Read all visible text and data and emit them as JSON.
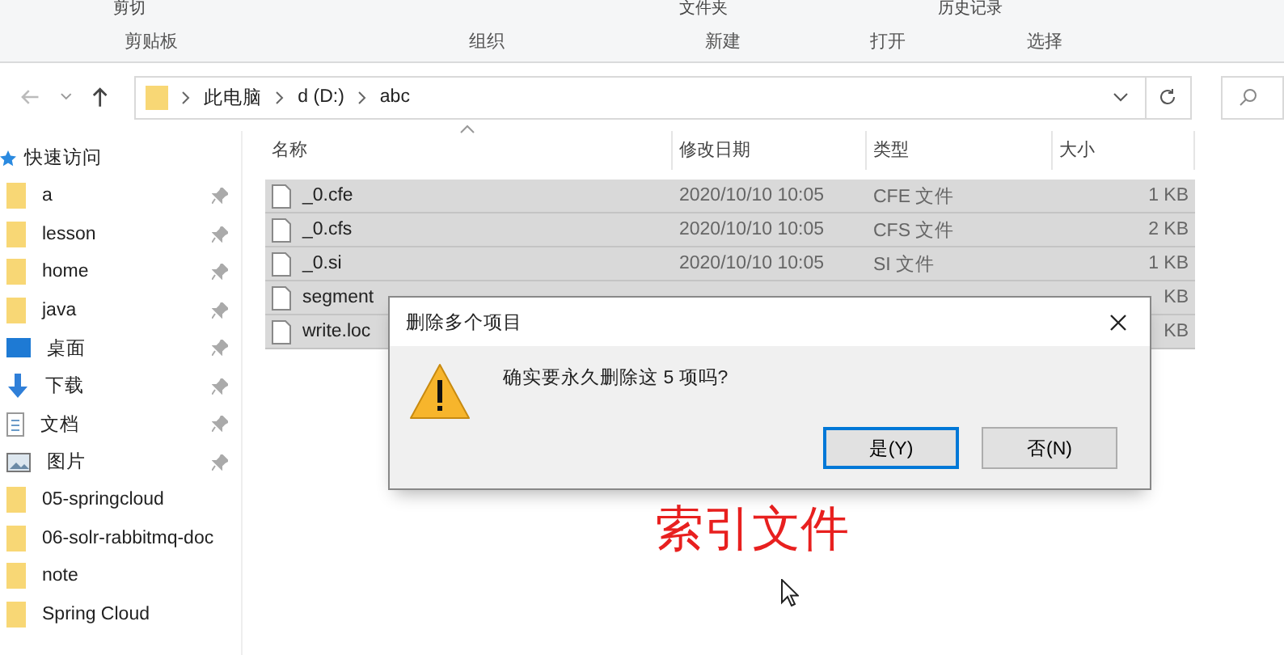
{
  "ribbon": {
    "commands": [
      "剪切",
      "文件夹",
      "历史记录"
    ],
    "groups": [
      "剪贴板",
      "组织",
      "新建",
      "打开",
      "选择"
    ]
  },
  "address_bar": {
    "path": [
      "此电脑",
      "d (D:)",
      "abc"
    ]
  },
  "sidebar": {
    "header": "快速访问",
    "items": [
      {
        "label": "a",
        "kind": "folder",
        "pinned": true
      },
      {
        "label": "lesson",
        "kind": "folder",
        "pinned": true
      },
      {
        "label": "home",
        "kind": "folder",
        "pinned": true
      },
      {
        "label": "java",
        "kind": "folder",
        "pinned": true
      },
      {
        "label": "桌面",
        "kind": "desktop",
        "pinned": true
      },
      {
        "label": "下载",
        "kind": "download",
        "pinned": true
      },
      {
        "label": "文档",
        "kind": "document",
        "pinned": true
      },
      {
        "label": "图片",
        "kind": "pictures",
        "pinned": true
      },
      {
        "label": "05-springcloud",
        "kind": "folder",
        "pinned": false
      },
      {
        "label": "06-solr-rabbitmq-doc",
        "kind": "folder",
        "pinned": false
      },
      {
        "label": "note",
        "kind": "folder",
        "pinned": false
      },
      {
        "label": "Spring Cloud",
        "kind": "folder",
        "pinned": false
      }
    ]
  },
  "table": {
    "columns": [
      "名称",
      "修改日期",
      "类型",
      "大小"
    ],
    "rows": [
      {
        "name": "_0.cfe",
        "date": "2020/10/10 10:05",
        "type": "CFE 文件",
        "size": "1 KB",
        "selected": true
      },
      {
        "name": "_0.cfs",
        "date": "2020/10/10 10:05",
        "type": "CFS 文件",
        "size": "2 KB",
        "selected": true
      },
      {
        "name": "_0.si",
        "date": "2020/10/10 10:05",
        "type": "SI 文件",
        "size": "1 KB",
        "selected": true
      },
      {
        "name": "segment",
        "size": "KB",
        "selected": true
      },
      {
        "name": "write.loc",
        "size": "KB",
        "selected": true
      }
    ]
  },
  "dialog": {
    "title": "删除多个项目",
    "message": "确实要永久删除这 5 项吗?",
    "buttons": [
      {
        "label": "是(Y)",
        "selected": true
      },
      {
        "label": "否(N)",
        "selected": false
      }
    ]
  },
  "caption": "索引文件"
}
